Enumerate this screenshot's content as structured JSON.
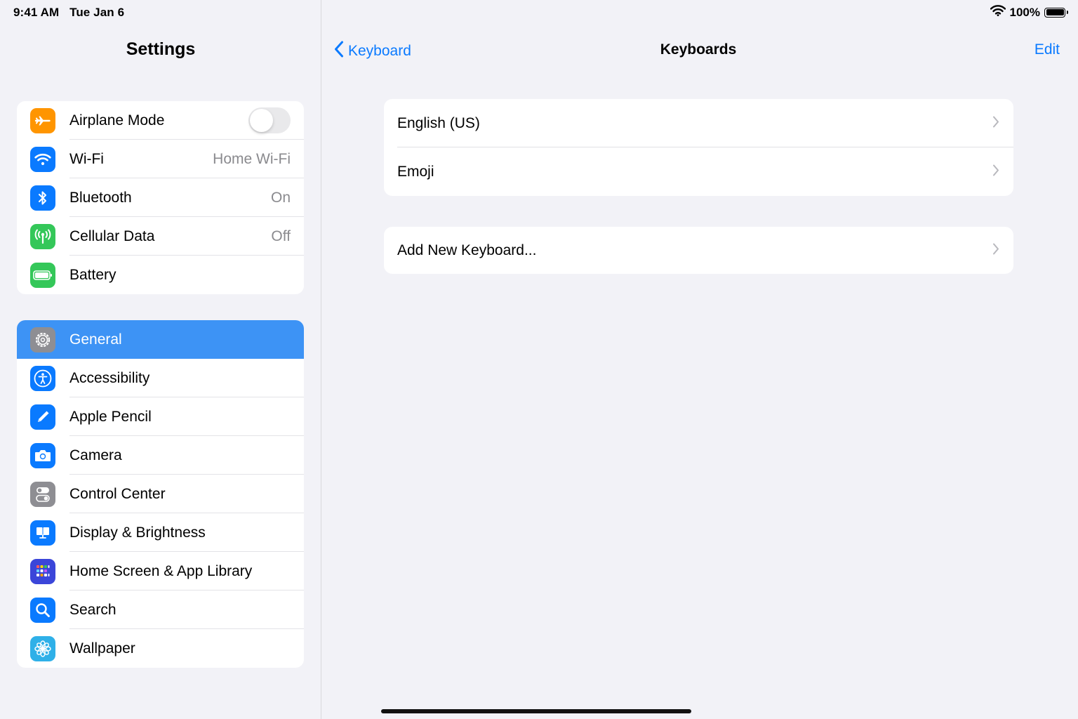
{
  "status_bar": {
    "time": "9:41 AM",
    "date": "Tue Jan 6",
    "battery_text": "100%",
    "battery_level": 1.0,
    "icons": [
      "wifi-icon",
      "battery-icon"
    ]
  },
  "sidebar": {
    "title": "Settings",
    "group1": [
      {
        "label": "Airplane Mode",
        "icon": "airplane-icon",
        "color": "#ff9500",
        "toggle": false
      },
      {
        "label": "Wi-Fi",
        "value": "Home Wi-Fi",
        "icon": "wifi-icon",
        "color": "#0a7aff"
      },
      {
        "label": "Bluetooth",
        "value": "On",
        "icon": "bluetooth-icon",
        "color": "#0a7aff"
      },
      {
        "label": "Cellular Data",
        "value": "Off",
        "icon": "antenna-icon",
        "color": "#34c759"
      },
      {
        "label": "Battery",
        "icon": "battery-icon",
        "color": "#34c759"
      }
    ],
    "group2": [
      {
        "label": "General",
        "icon": "gear-icon",
        "color": "#8e8e93",
        "selected": true
      },
      {
        "label": "Accessibility",
        "icon": "accessibility-icon",
        "color": "#0a7aff"
      },
      {
        "label": "Apple Pencil",
        "icon": "pencil-icon",
        "color": "#0a7aff"
      },
      {
        "label": "Camera",
        "icon": "camera-icon",
        "color": "#0a7aff"
      },
      {
        "label": "Control Center",
        "icon": "switches-icon",
        "color": "#8e8e93"
      },
      {
        "label": "Display & Brightness",
        "icon": "display-icon",
        "color": "#0a7aff"
      },
      {
        "label": "Home Screen & App Library",
        "icon": "app-grid-icon",
        "color": "#3b46d9"
      },
      {
        "label": "Search",
        "icon": "search-icon",
        "color": "#0a7aff"
      },
      {
        "label": "Wallpaper",
        "icon": "flower-icon",
        "color": "#2fb0e8"
      }
    ]
  },
  "detail": {
    "back_label": "Keyboard",
    "title": "Keyboards",
    "edit_label": "Edit",
    "keyboards": [
      {
        "label": "English (US)"
      },
      {
        "label": "Emoji"
      }
    ],
    "add_label": "Add New Keyboard..."
  },
  "colors": {
    "accent": "#0a7aff",
    "selection": "#3d93f5",
    "background": "#f2f2f7"
  }
}
